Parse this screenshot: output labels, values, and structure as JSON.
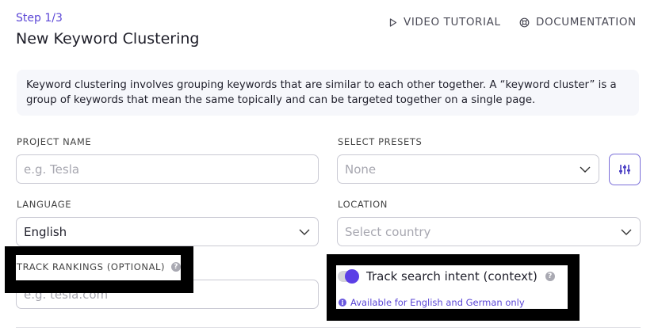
{
  "header": {
    "step": "Step 1/3",
    "title": "New Keyword Clustering",
    "video_tutorial": "VIDEO TUTORIAL",
    "documentation": "DOCUMENTATION"
  },
  "info_text": "Keyword clustering involves grouping keywords that are similar to each other together. A “keyword cluster” is a group of keywords that mean the same topically and can be targeted together on a single page.",
  "form": {
    "project_name": {
      "label": "PROJECT NAME",
      "placeholder": "e.g. Tesla"
    },
    "select_presets": {
      "label": "SELECT PRESETS",
      "value": "None"
    },
    "language": {
      "label": "LANGUAGE",
      "value": "English"
    },
    "location": {
      "label": "LOCATION",
      "placeholder": "Select country"
    },
    "track_rankings": {
      "label": "TRACK RANKINGS (OPTIONAL)",
      "placeholder": "e.g. tesla.com"
    },
    "search_intent": {
      "label": "Track search intent (context)",
      "note": "Available for English and German only",
      "enabled": true
    }
  },
  "colors": {
    "accent": "#5b3ee6",
    "accent_text": "#5b46d6",
    "redaction": "#000000"
  }
}
